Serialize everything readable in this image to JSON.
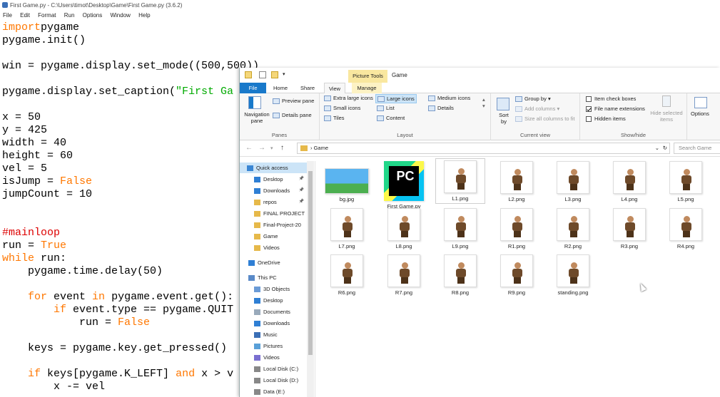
{
  "idle": {
    "title": "First Game.py - C:\\Users\\timot\\Desktop\\Game\\First Game.py (3.6.2)",
    "menu": [
      "File",
      "Edit",
      "Format",
      "Run",
      "Options",
      "Window",
      "Help"
    ],
    "code": [
      [
        [
          "kw",
          "import"
        ],
        [
          "",
          "pygame"
        ]
      ],
      [
        [
          "",
          "pygame.init()"
        ]
      ],
      [],
      [
        [
          "",
          "win = pygame.display.set_mode((500,500))"
        ]
      ],
      [],
      [
        [
          "",
          "pygame.display.set_caption("
        ],
        [
          "str",
          "\"First Ga"
        ]
      ],
      [],
      [
        [
          "",
          "x = 50"
        ]
      ],
      [
        [
          "",
          "y = 425"
        ]
      ],
      [
        [
          "",
          "width = 40"
        ]
      ],
      [
        [
          "",
          "height = 60"
        ]
      ],
      [
        [
          "",
          "vel = 5"
        ]
      ],
      [
        [
          "",
          "isJump = "
        ],
        [
          "kw",
          "False"
        ]
      ],
      [
        [
          "",
          "jumpCount = 10"
        ]
      ],
      [],
      [],
      [
        [
          "cm",
          "#mainloop"
        ]
      ],
      [
        [
          "",
          "run = "
        ],
        [
          "kw",
          "True"
        ]
      ],
      [
        [
          "kw",
          "while"
        ],
        [
          "",
          " run:"
        ]
      ],
      [
        [
          "",
          "    pygame.time.delay(50)"
        ]
      ],
      [],
      [
        [
          "",
          "    "
        ],
        [
          "kw",
          "for"
        ],
        [
          "",
          " event "
        ],
        [
          "kw",
          "in"
        ],
        [
          "",
          " pygame.event.get():"
        ]
      ],
      [
        [
          "",
          "        "
        ],
        [
          "kw",
          "if"
        ],
        [
          "",
          " event.type == pygame.QUIT"
        ]
      ],
      [
        [
          "",
          "            run = "
        ],
        [
          "kw",
          "False"
        ]
      ],
      [],
      [
        [
          "",
          "    keys = pygame.key.get_pressed()"
        ]
      ],
      [],
      [
        [
          "",
          "    "
        ],
        [
          "kw",
          "if"
        ],
        [
          "",
          " keys[pygame.K_LEFT] "
        ],
        [
          "kw",
          "and"
        ],
        [
          "",
          " x > v"
        ]
      ],
      [
        [
          "",
          "        x -= vel"
        ]
      ]
    ]
  },
  "explorer": {
    "ctx_tab": "Picture Tools",
    "window_title": "Game",
    "tabs": {
      "file": "File",
      "home": "Home",
      "share": "Share",
      "view": "View",
      "manage": "Manage"
    },
    "panes": {
      "navigation": "Navigation pane",
      "preview": "Preview pane",
      "details": "Details pane",
      "label": "Panes"
    },
    "layout": {
      "extra_large": "Extra large icons",
      "large": "Large icons",
      "medium": "Medium icons",
      "small": "Small icons",
      "list": "List",
      "details": "Details",
      "tiles": "Tiles",
      "content": "Content",
      "label": "Layout"
    },
    "current_view": {
      "sort": "Sort by",
      "group": "Group by",
      "add_cols": "Add columns",
      "size_cols": "Size all columns to fit",
      "label": "Current view"
    },
    "show_hide": {
      "item_cb": "Item check boxes",
      "ext": "File name extensions",
      "hidden": "Hidden items",
      "hide_sel": "Hide selected items",
      "label": "Show/hide"
    },
    "options": "Options",
    "address": "Game",
    "search": "Search Game",
    "nav_items": [
      "Quick access",
      "Desktop",
      "Downloads",
      "repos",
      "FINAL PROJECT",
      "Final-Project-20",
      "Game",
      "Videos",
      "OneDrive",
      "This PC",
      "3D Objects",
      "Desktop",
      "Documents",
      "Downloads",
      "Music",
      "Pictures",
      "Videos",
      "Local Disk (C:)",
      "Local Disk (D:)",
      "Data (E:)"
    ],
    "files": [
      "bg.jpg",
      "First Game.py",
      "L1.png",
      "L2.png",
      "L3.png",
      "L4.png",
      "L5.png",
      "L7.png",
      "L8.png",
      "L9.png",
      "R1.png",
      "R2.png",
      "R3.png",
      "R4.png",
      "R6.png",
      "R7.png",
      "R8.png",
      "R9.png",
      "standing.png"
    ]
  },
  "colors": {
    "keyword": "#ff7700",
    "comment": "#dd0000",
    "string": "#00aa00",
    "accent": "#1979ca"
  }
}
